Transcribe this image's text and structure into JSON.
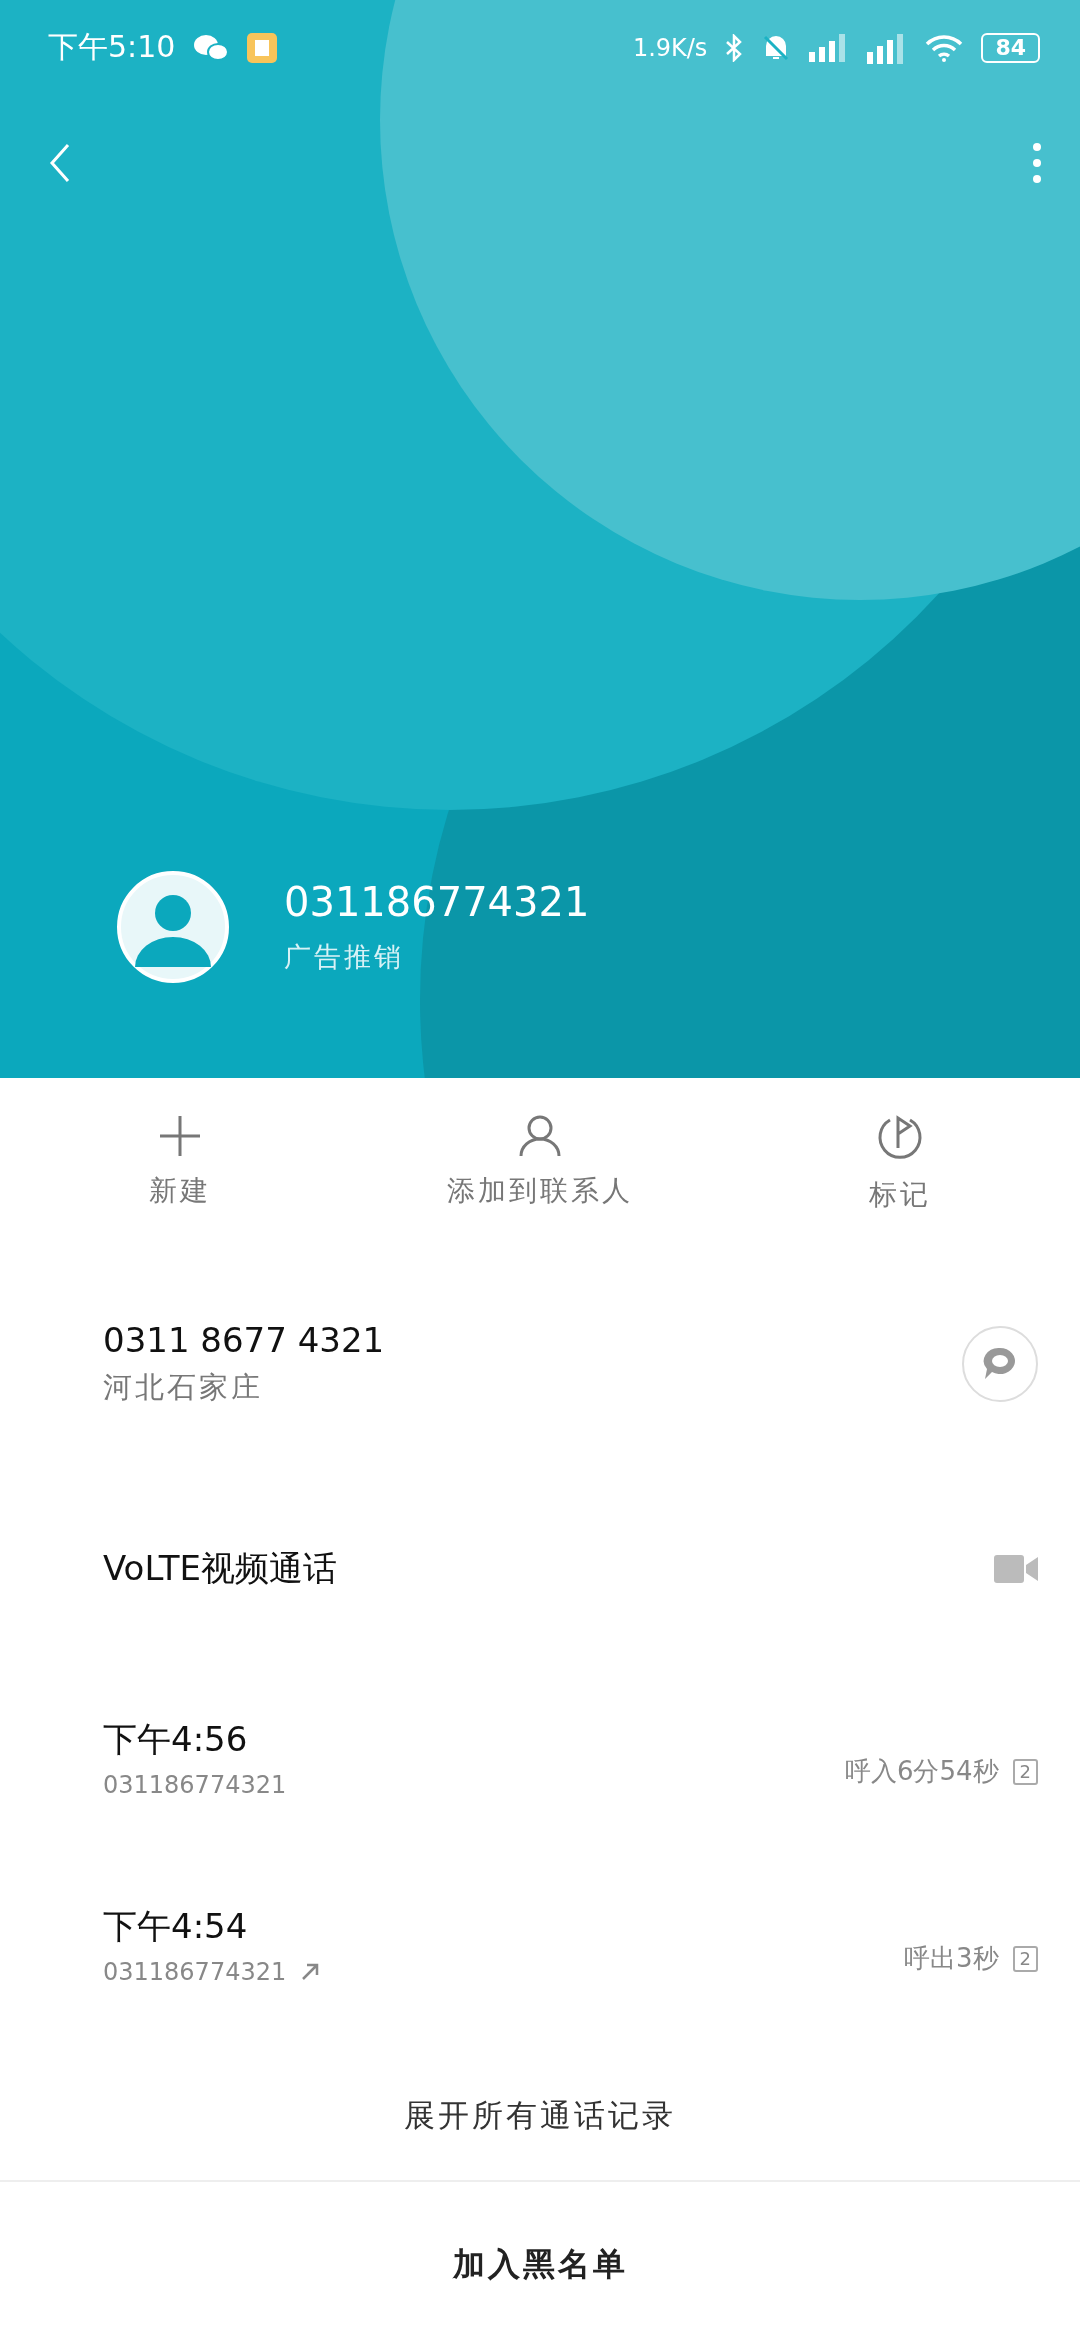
{
  "status_bar": {
    "time": "下午5:10",
    "speed": "1.9K/s",
    "battery": "84"
  },
  "header": {
    "number": "031186774321",
    "tag": "广告推销"
  },
  "actions": [
    {
      "kind": "add",
      "label": "新建"
    },
    {
      "kind": "contact",
      "label": "添加到联系人"
    },
    {
      "kind": "mark",
      "label": "标记"
    }
  ],
  "number_row": {
    "number": "0311 8677 4321",
    "location": "河北石家庄"
  },
  "video_call": {
    "label": "VoLTE视频通话"
  },
  "calls": [
    {
      "time": "下午4:56",
      "number": "031186774321",
      "outgoing": false,
      "detail": "呼入6分54秒",
      "sim": "2"
    },
    {
      "time": "下午4:54",
      "number": "031186774321",
      "outgoing": true,
      "detail": "呼出3秒",
      "sim": "2"
    }
  ],
  "expand": "展开所有通话记录",
  "blacklist": "加入黑名单"
}
